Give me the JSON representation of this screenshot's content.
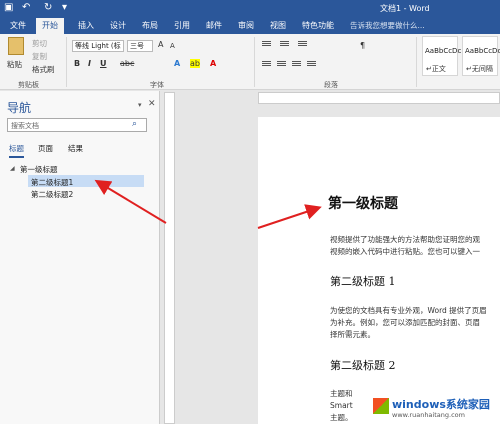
{
  "title_bar": {
    "doc_title": "文档1 - Word"
  },
  "tabs": [
    "文件",
    "开始",
    "插入",
    "设计",
    "布局",
    "引用",
    "邮件",
    "审阅",
    "视图",
    "特色功能"
  ],
  "tell_me": "告诉我您想要做什么...",
  "ribbon": {
    "clipboard": {
      "paste": "粘贴",
      "cut": "剪切",
      "copy": "复制",
      "format_painter": "格式刷",
      "label": "剪贴板"
    },
    "font": {
      "name": "等线 Light (标",
      "size": "三号",
      "label": "字体"
    },
    "paragraph": {
      "label": "段落"
    },
    "styles": [
      {
        "sample": "AaBbCcDc",
        "label": "↵正文"
      },
      {
        "sample": "AaBbCcDc",
        "label": "↵无间隔"
      }
    ]
  },
  "nav": {
    "title": "导航",
    "search_placeholder": "搜索文档",
    "tabs": [
      "标题",
      "页面",
      "结果"
    ],
    "tree": [
      "第一级标题",
      "第二级标题1",
      "第二级标题2"
    ]
  },
  "document": {
    "h1": "第一级标题",
    "p1": [
      "视频提供了功能强大的方法帮助您证明您的观",
      "视频的嵌入代码中进行粘贴。您也可以键入一"
    ],
    "h2a": "第二级标题 1",
    "p2": [
      "为使您的文档具有专业外观，Word 提供了页眉",
      "为补充。例如，您可以添加匹配的封面、页眉",
      "择所需元素。"
    ],
    "h2b": "第二级标题 2",
    "p3": [
      "主题和",
      "Smart",
      "主题。"
    ]
  },
  "watermark": {
    "text": "windows系统家园",
    "url": "www.ruanhaitang.com"
  },
  "colors": {
    "accent": "#2b579a",
    "arrow": "#e02020"
  }
}
